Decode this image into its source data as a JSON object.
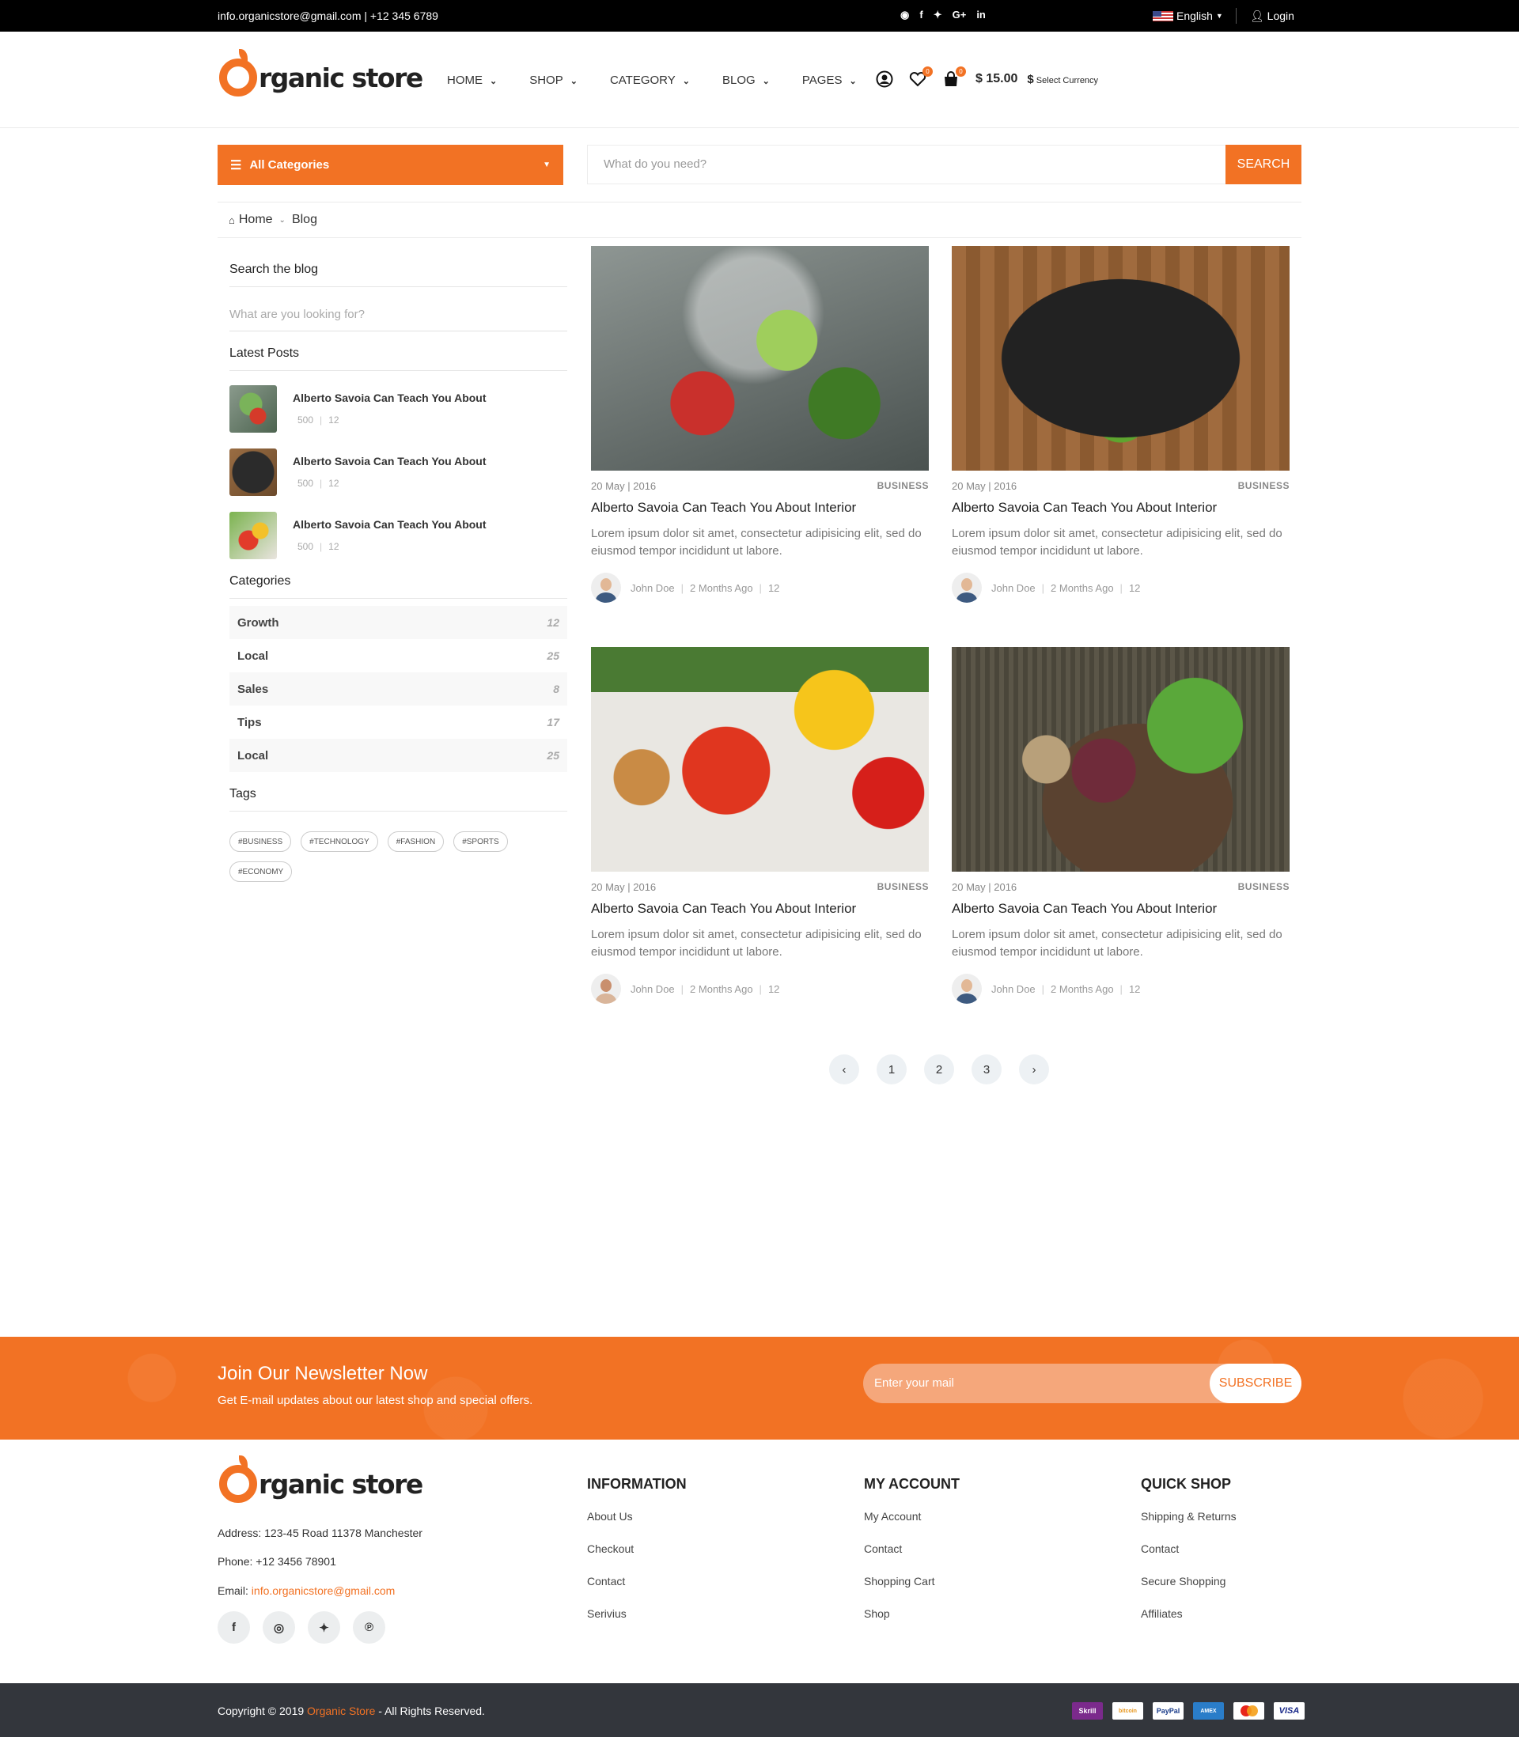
{
  "topbar": {
    "contact": "info.organicstore@gmail.com   |   +12 345 6789",
    "social": [
      "rss-icon",
      "facebook-icon",
      "twitter-icon",
      "google-plus-icon",
      "linkedin-icon"
    ],
    "language": "English",
    "login": "Login"
  },
  "header": {
    "logo_text": "rganic store",
    "nav": [
      {
        "label": "HOME"
      },
      {
        "label": "SHOP"
      },
      {
        "label": "CATEGORY"
      },
      {
        "label": "BLOG"
      },
      {
        "label": "PAGES"
      }
    ],
    "wishlist_count": "0",
    "cart_count": "0",
    "cart_total": "$ 15.00",
    "currency_symbol": "$",
    "currency_label": "Select Currency"
  },
  "searchbar": {
    "categories_label": "All Categories",
    "placeholder": "What do you need?",
    "button": "SEARCH"
  },
  "breadcrumb": {
    "home": "Home",
    "current": "Blog"
  },
  "sidebar": {
    "search_title": "Search the blog",
    "search_placeholder": "What are you looking for?",
    "latest_title": "Latest Posts",
    "latest_posts": [
      {
        "title": "Alberto Savoia Can Teach You About",
        "views": "500",
        "comments": "12"
      },
      {
        "title": "Alberto Savoia Can Teach You About",
        "views": "500",
        "comments": "12"
      },
      {
        "title": "Alberto Savoia Can Teach You About",
        "views": "500",
        "comments": "12"
      }
    ],
    "categories_title": "Categories",
    "categories": [
      {
        "name": "Growth",
        "count": "12"
      },
      {
        "name": "Local",
        "count": "25"
      },
      {
        "name": "Sales",
        "count": "8"
      },
      {
        "name": "Tips",
        "count": "17"
      },
      {
        "name": "Local",
        "count": "25"
      }
    ],
    "tags_title": "Tags",
    "tags": [
      "#BUSINESS",
      "#TECHNOLOGY",
      "#FASHION",
      "#SPORTS",
      "#ECONOMY"
    ]
  },
  "posts": [
    {
      "date": "20 May | 2016",
      "category": "BUSINESS",
      "title": "Alberto Savoia Can Teach You About Interior",
      "excerpt": "Lorem ipsum dolor sit amet, consectetur adipisicing elit, sed do eiusmod tempor incididunt ut labore.",
      "author": "John Doe",
      "time": "2 Months Ago",
      "comments": "12"
    },
    {
      "date": "20 May | 2016",
      "category": "BUSINESS",
      "title": "Alberto Savoia Can Teach You About Interior",
      "excerpt": "Lorem ipsum dolor sit amet, consectetur adipisicing elit, sed do eiusmod tempor incididunt ut labore.",
      "author": "John Doe",
      "time": "2 Months Ago",
      "comments": "12"
    },
    {
      "date": "20 May | 2016",
      "category": "BUSINESS",
      "title": "Alberto Savoia Can Teach You About Interior",
      "excerpt": "Lorem ipsum dolor sit amet, consectetur adipisicing elit, sed do eiusmod tempor incididunt ut labore.",
      "author": "John Doe",
      "time": "2 Months Ago",
      "comments": "12"
    },
    {
      "date": "20 May | 2016",
      "category": "BUSINESS",
      "title": "Alberto Savoia Can Teach You About Interior",
      "excerpt": "Lorem ipsum dolor sit amet, consectetur adipisicing elit, sed do eiusmod tempor incididunt ut labore.",
      "author": "John Doe",
      "time": "2 Months Ago",
      "comments": "12"
    }
  ],
  "pagination": {
    "prev": "‹",
    "pages": [
      "1",
      "2",
      "3"
    ],
    "next": "›"
  },
  "newsletter": {
    "title": "Join Our Newsletter Now",
    "subtitle": "Get E-mail updates about our latest shop and special offers.",
    "placeholder": "Enter your mail",
    "button": "SUBSCRIBE"
  },
  "footer": {
    "logo_text": "rganic store",
    "address": "Address: 123-45 Road 11378 Manchester",
    "phone": "Phone: +12 3456 78901",
    "email_label": "Email: ",
    "email": "info.organicstore@gmail.com",
    "social": [
      "facebook-icon",
      "instagram-icon",
      "twitter-icon",
      "pinterest-icon"
    ],
    "columns": [
      {
        "title": "INFORMATION",
        "links": [
          "About Us",
          "Checkout",
          "Contact",
          "Serivius"
        ]
      },
      {
        "title": "MY ACCOUNT",
        "links": [
          "My Account",
          "Contact",
          "Shopping Cart",
          "Shop"
        ]
      },
      {
        "title": "QUICK SHOP",
        "links": [
          "Shipping & Returns",
          "Contact",
          "Secure Shopping",
          "Affiliates"
        ]
      }
    ],
    "copyright_pre": "Copyright © 2019 ",
    "copyright_brand": "Organic Store",
    "copyright_post": " - All Rights Reserved.",
    "payments": [
      "Skrill",
      "bitcoin",
      "PayPal",
      "AMEX",
      "MasterCard",
      "VISA"
    ]
  },
  "colors": {
    "accent": "#f27224",
    "dark": "#33363c",
    "top": "#000000"
  }
}
